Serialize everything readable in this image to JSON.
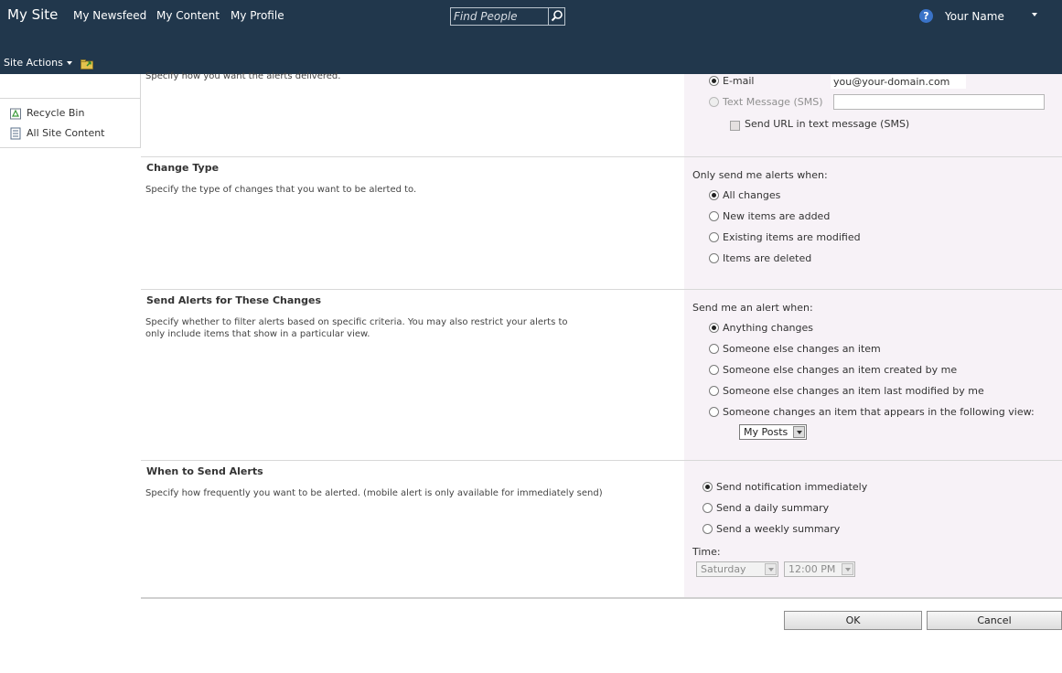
{
  "header": {
    "brand": "My Site",
    "nav": [
      "My Newsfeed",
      "My Content",
      "My Profile"
    ],
    "find_placeholder": "Find People",
    "help_glyph": "?",
    "user_name": "Your Name",
    "site_actions": "Site Actions"
  },
  "sidebar": {
    "items": [
      {
        "label": "Recycle Bin",
        "icon": "recycle-bin-icon"
      },
      {
        "label": "All Site Content",
        "icon": "all-site-content-icon"
      }
    ]
  },
  "delivery": {
    "description": "Specify how you want the alerts delivered.",
    "email_label": "E-mail",
    "email_value": "you@your-domain.com",
    "sms_label": "Text Message (SMS)",
    "sms_value": "",
    "send_url_label": "Send URL in text message (SMS)"
  },
  "change_type": {
    "title": "Change Type",
    "description": "Specify the type of changes that you want to be alerted to.",
    "prompt": "Only send me alerts when:",
    "options": [
      "All changes",
      "New items are added",
      "Existing items are modified",
      "Items are deleted"
    ],
    "selected": 0
  },
  "filter": {
    "title": "Send Alerts for These Changes",
    "description": "Specify whether to filter alerts based on specific criteria. You may also restrict your alerts to only include items that show in a particular view.",
    "prompt": "Send me an alert when:",
    "options": [
      "Anything changes",
      "Someone else changes an item",
      "Someone else changes an item created by me",
      "Someone else changes an item last modified by me",
      "Someone changes an item that appears in the following view:"
    ],
    "selected": 0,
    "view_value": "My Posts"
  },
  "when": {
    "title": "When to Send Alerts",
    "description": "Specify how frequently you want to be alerted. (mobile alert is only available for immediately send)",
    "options": [
      "Send notification immediately",
      "Send a daily summary",
      "Send a weekly summary"
    ],
    "selected": 0,
    "time_label": "Time:",
    "day_value": "Saturday",
    "time_value": "12:00 PM"
  },
  "actions": {
    "ok": "OK",
    "cancel": "Cancel"
  },
  "colors": {
    "topbar": "#21374c",
    "control_panel_bg": "#f7f2f7"
  }
}
